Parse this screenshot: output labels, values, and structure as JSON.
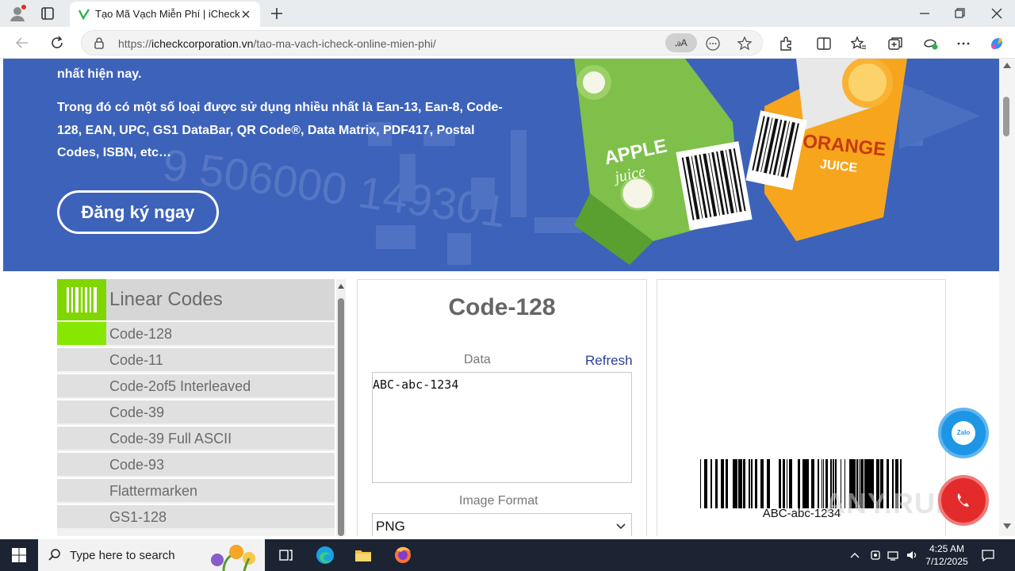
{
  "browser": {
    "tab_title": "Tạo Mã Vạch Miễn Phí | iCheck",
    "url_host": "icheckcorporation.vn",
    "url_prefix": "https://",
    "url_path": "/tao-ma-vach-icheck-online-mien-phi/",
    "read_aloud_label": "ꭿA"
  },
  "hero": {
    "line1": "nhất hiện nay.",
    "line2": "Trong đó có một số loại được sử dụng nhiều nhất là Ean-13, Ean-8, Code-128, EAN, UPC, GS1 DataBar, QR Code®, Data Matrix, PDF417, Postal Codes, ISBN, etc…",
    "cta": "Đăng ký ngay",
    "bg_numbers": "9 506000 149301",
    "carton1_top": "APPLE",
    "carton1_bottom": "juice",
    "carton2_top": "ORANGE",
    "carton2_bottom": "JUICE"
  },
  "codelist": {
    "header": "Linear Codes",
    "items": [
      {
        "label": "Code-128",
        "active": true
      },
      {
        "label": "Code-11",
        "active": false
      },
      {
        "label": "Code-2of5 Interleaved",
        "active": false
      },
      {
        "label": "Code-39",
        "active": false
      },
      {
        "label": "Code-39 Full ASCII",
        "active": false
      },
      {
        "label": "Code-93",
        "active": false
      },
      {
        "label": "Flattermarken",
        "active": false
      },
      {
        "label": "GS1-128",
        "active": false
      }
    ]
  },
  "form": {
    "title": "Code-128",
    "data_label": "Data",
    "refresh_label": "Refresh",
    "data_value": "ABC-abc-1234",
    "format_label": "Image Format",
    "format_value": "PNG"
  },
  "preview": {
    "barcode_text": "ABC-abc-1234",
    "zalo_label": "Zalo"
  },
  "watermark": "ANY.RUN",
  "taskbar": {
    "search_placeholder": "Type here to search",
    "time": "4:25 AM",
    "date": "7/12/2025"
  },
  "colors": {
    "hero_bg": "#3d62b9",
    "accent_green": "#7fd600",
    "refresh_link": "#2c3e9a",
    "zalo_blue": "#1e96e6",
    "call_red": "#e32b2b"
  }
}
